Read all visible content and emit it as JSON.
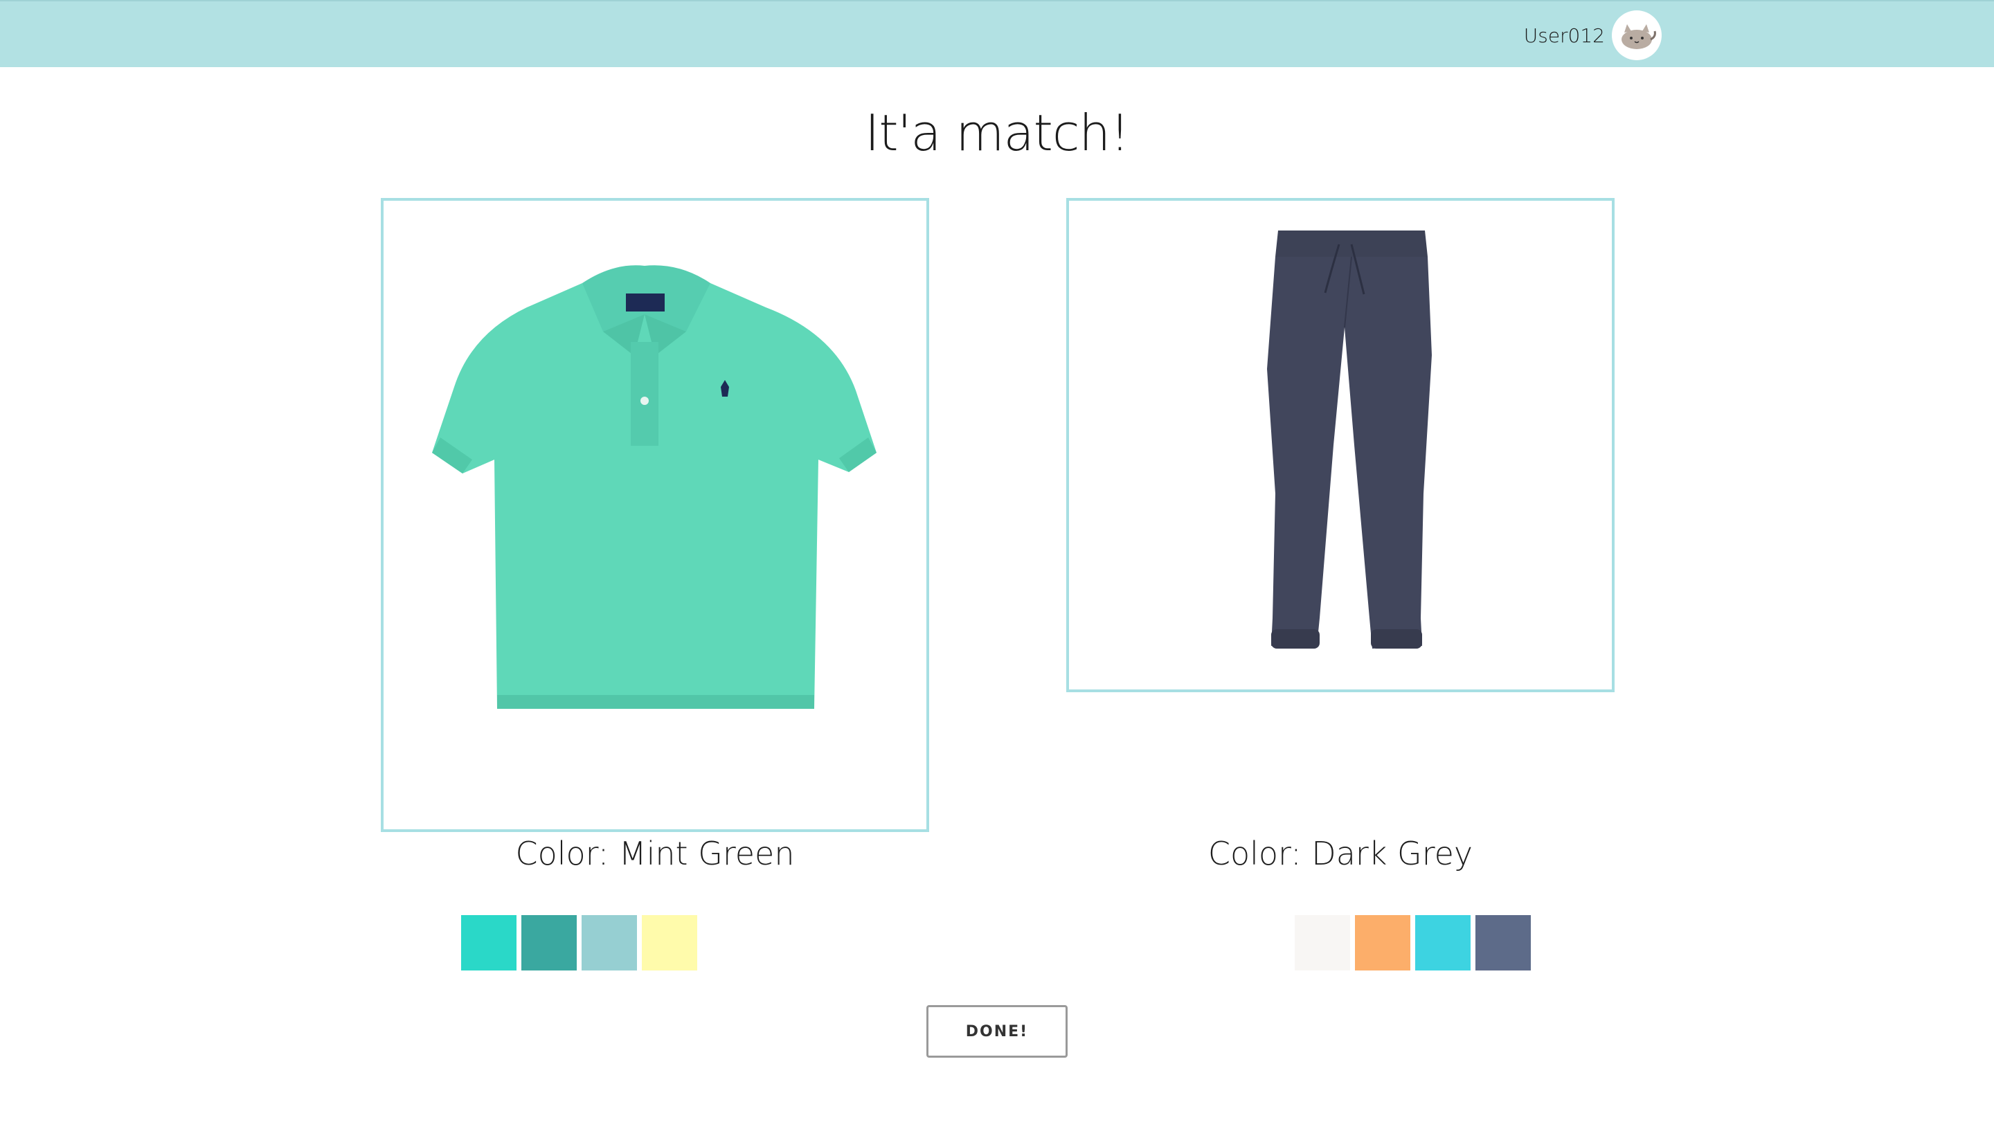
{
  "header": {
    "username": "User012",
    "avatar_icon": "cat-avatar-icon",
    "background": "#b2e1e3"
  },
  "page": {
    "title": "It'a match!"
  },
  "items": [
    {
      "kind": "polo-shirt",
      "color_label": "Color: Mint Green",
      "palette": [
        "#2ad8c8",
        "#3aa8a0",
        "#96cfd2",
        "#fffbab"
      ]
    },
    {
      "kind": "jogger-pants",
      "color_label": "Color: Dark Grey",
      "palette": [
        "#f8f6f4",
        "#fcae6a",
        "#3dd3e1",
        "#5d6b89"
      ]
    }
  ],
  "actions": {
    "done_label": "DONE!"
  }
}
